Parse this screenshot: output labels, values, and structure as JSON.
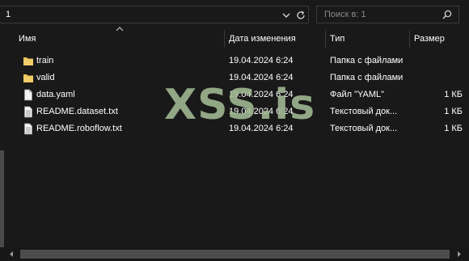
{
  "address_bar": {
    "path": "1"
  },
  "search": {
    "placeholder": "Поиск в: 1"
  },
  "columns": {
    "name": "Имя",
    "date": "Дата изменения",
    "type": "Тип",
    "size": "Размер"
  },
  "files": [
    {
      "icon": "folder-icon",
      "name": "train",
      "date": "19.04.2024 6:24",
      "type": "Папка с файлами",
      "size": ""
    },
    {
      "icon": "folder-icon",
      "name": "valid",
      "date": "19.04.2024 6:24",
      "type": "Папка с файлами",
      "size": ""
    },
    {
      "icon": "yaml-file-icon",
      "name": "data.yaml",
      "date": "19.04.2024 6:24",
      "type": "Файл \"YAML\"",
      "size": "1 КБ"
    },
    {
      "icon": "text-file-icon",
      "name": "README.dataset.txt",
      "date": "19.04.2024 6:24",
      "type": "Текстовый док...",
      "size": "1 КБ"
    },
    {
      "icon": "text-file-icon",
      "name": "README.roboflow.txt",
      "date": "19.04.2024 6:24",
      "type": "Текстовый док...",
      "size": "1 КБ"
    }
  ],
  "watermark": "XSS.is",
  "colors": {
    "background": "#191919",
    "folder": "#e8c057",
    "watermark": "#a3bb94"
  }
}
